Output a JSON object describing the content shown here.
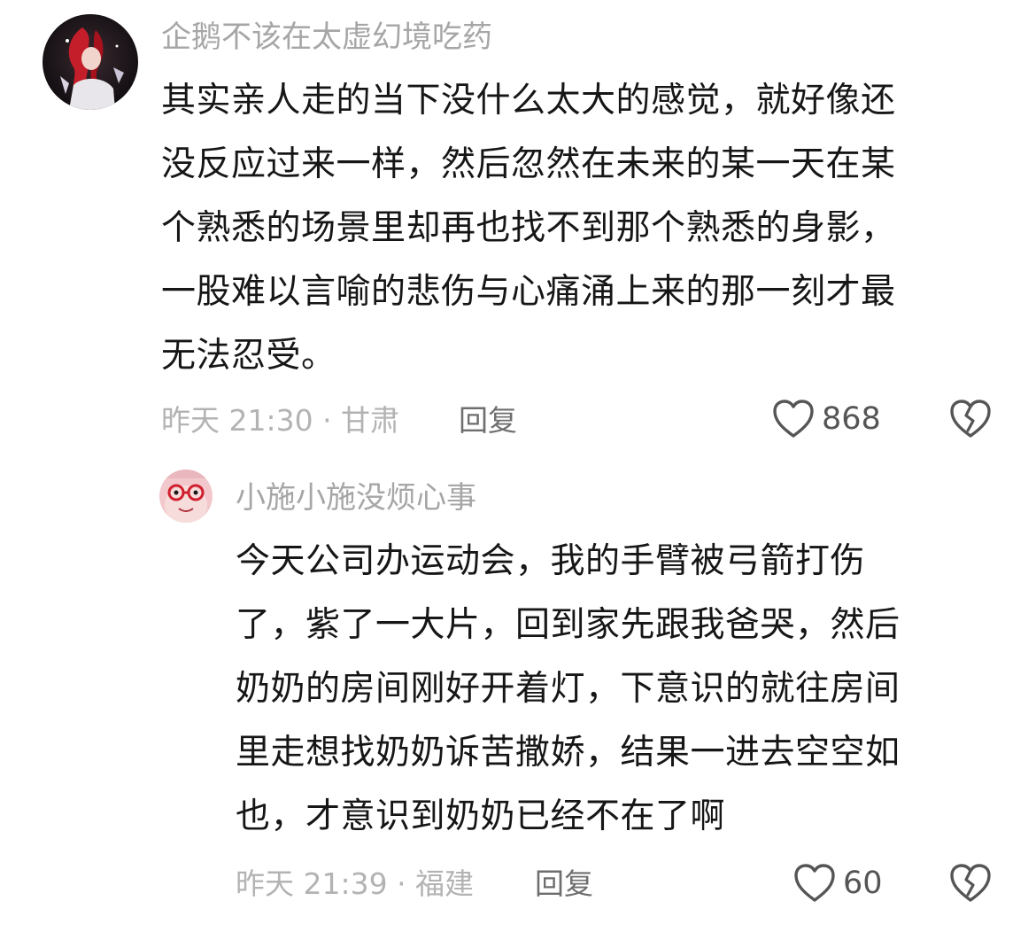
{
  "comments": [
    {
      "username": "企鹅不该在太虚幻境吃药",
      "lines": [
        "其实亲人走的当下没什么太大的感觉，就好像还",
        "没反应过来一样，然后忽然在未来的某一天在某",
        "个熟悉的场景里却再也找不到那个熟悉的身影，",
        "一股难以言喻的悲伤与心痛涌上来的那一刻才最",
        "无法忍受。"
      ],
      "time_location": "昨天 21:30 · 甘肃",
      "reply_label": "回复",
      "likes": "868"
    },
    {
      "username": "小施小施没烦心事",
      "lines": [
        "今天公司办运动会，我的手臂被弓箭打伤",
        "了，紫了一大片，回到家先跟我爸哭，然后",
        "奶奶的房间刚好开着灯，下意识的就往房间",
        "里走想找奶奶诉苦撒娇，结果一进去空空如",
        "也，才意识到奶奶已经不在了啊"
      ],
      "time_location": "昨天 21:39 · 福建",
      "reply_label": "回复",
      "likes": "60"
    }
  ],
  "icons": {
    "like": "heart-outline-icon",
    "dislike": "broken-heart-icon"
  }
}
